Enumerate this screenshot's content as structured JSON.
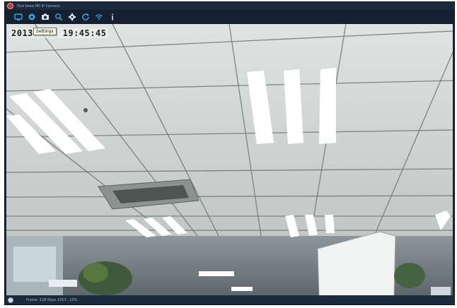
{
  "window": {
    "title": "Fyre'okee HD IP Camera"
  },
  "toolbar": {
    "buttons": [
      {
        "name": "monitor",
        "icon": "monitor-icon"
      },
      {
        "name": "record",
        "icon": "camera-icon"
      },
      {
        "name": "snapshot",
        "icon": "snapshot-icon"
      },
      {
        "name": "search",
        "icon": "search-icon"
      },
      {
        "name": "settings",
        "icon": "gear-icon"
      },
      {
        "name": "refresh",
        "icon": "refresh-icon"
      },
      {
        "name": "wifi",
        "icon": "wifi-icon"
      },
      {
        "name": "info",
        "icon": "info-icon"
      }
    ],
    "accent_color": "#3aa6e0",
    "tooltip": "Settings"
  },
  "osd": {
    "date": "2013-",
    "time": "19:45:45"
  },
  "status": {
    "icon": "power-icon",
    "text": "Frame: 128 Kbps  1953 : 10%"
  }
}
